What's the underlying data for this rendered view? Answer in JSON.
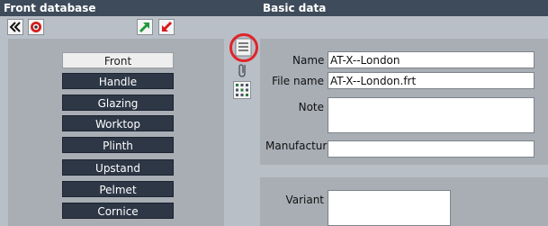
{
  "left_header": {
    "title": "Front database"
  },
  "right_header": {
    "title": "Basic data"
  },
  "toolbar": {
    "collapse_icon": "double-chevron-left-icon",
    "stop_icon": "stop-circle-icon",
    "export_icon": "arrow-up-right-green-icon",
    "import_icon": "arrow-down-left-red-icon"
  },
  "front_menu": {
    "items": [
      {
        "label": "Front",
        "active": true
      },
      {
        "label": "Handle",
        "active": false
      },
      {
        "label": "Glazing",
        "active": false
      },
      {
        "label": "Worktop",
        "active": false
      },
      {
        "label": "Plinth",
        "active": false
      },
      {
        "label": "Upstand",
        "active": false
      },
      {
        "label": "Pelmet",
        "active": false
      },
      {
        "label": "Cornice",
        "active": false
      }
    ]
  },
  "side_icons": [
    "document-lines-icon",
    "paperclip-icon",
    "grid-dots-icon"
  ],
  "highlight_color": "#e0242a",
  "basic_data": {
    "name_label": "Name",
    "name_value": "AT-X--London",
    "file_label": "File name",
    "file_value": "AT-X--London.frt",
    "note_label": "Note",
    "note_value": "",
    "manufacturer_label": "Manufactur",
    "manufacturer_value": ""
  },
  "variant": {
    "label": "Variant",
    "value": ""
  }
}
